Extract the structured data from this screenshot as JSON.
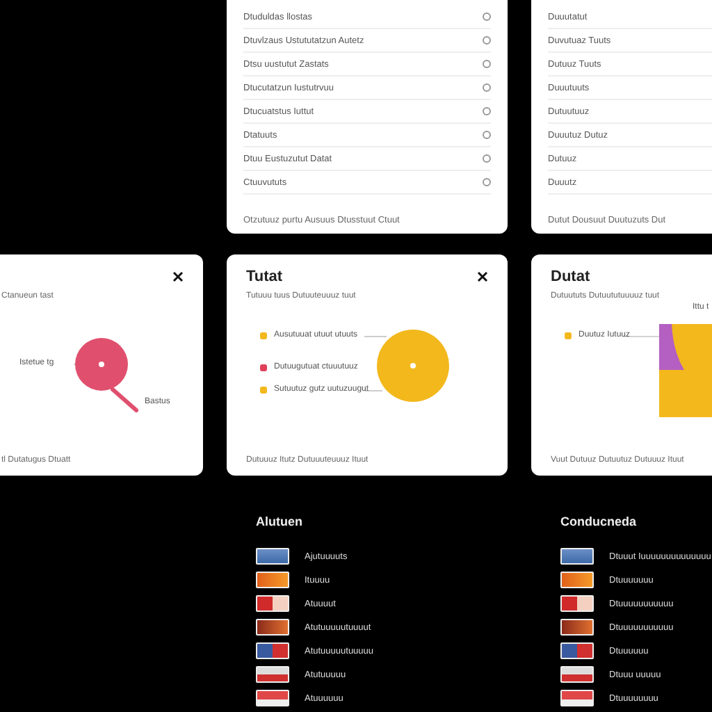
{
  "top_cards": [
    {
      "rows": [
        "Dtuduldas llostas",
        "Dtuvlzaus Ustututatzun Autetz",
        "Dtsu uustutut Zastats",
        "Dtucutatzun Iustutrvuu",
        "Dtucuatstus Iuttut",
        "Dtatuuts",
        "Dtuu Eustuzutut Datat",
        "Ctuuvututs"
      ],
      "footer": "Otzutuuz purtu Ausuus Dtusstuut Ctuut"
    },
    {
      "rows": [
        "Duuutatut",
        "Duvutuaz Tuuts",
        "Dutuuz Tuuts",
        "Duuutuuts",
        "Dutuutuuz",
        "Duuutuz Dutuz",
        "Dutuuz",
        "Duuutz"
      ],
      "footer": "Dutut Dousuut Duutuzuts Dut"
    }
  ],
  "chart_cards": [
    {
      "kind": "pin",
      "close": true,
      "subtitle": "Ctanueun tast",
      "callouts": [
        "Istetue tg",
        "Bastus"
      ],
      "footer": "tl Dutatugus Dtuatt"
    },
    {
      "kind": "circle",
      "title": "Tutat",
      "close": true,
      "subtitle": "Tutuuu tuus Dutuuteuuuz tuut",
      "legend": [
        {
          "label": "Ausutuuat utuut utuuts",
          "color": "#f2b81c"
        },
        {
          "label": "Dutuugutuat ctuuutuuz",
          "color": "#e0405a"
        },
        {
          "label": "Sutuutuz gutz uutuzuugut",
          "color": "#f2b81c"
        }
      ],
      "footer": "Dutuuuz Itutz Dutuuuteuuuz Ituut"
    },
    {
      "kind": "block",
      "title": "Dutat",
      "close": false,
      "subtitle": "Dutuututs Dutuututuuuuz tuut",
      "callouts": [
        "Ittu t"
      ],
      "legend": [
        {
          "label": "Duutuz Iutuuz",
          "color": "#f2b81c"
        }
      ],
      "footer": "Vuut Dutuuz Dutuutuz Dutuuuz Ituut"
    }
  ],
  "media_lists": [
    {
      "heading": "Alutuen",
      "items": [
        "Ajutuuuuts",
        "Ituuuu",
        "Atuuuut",
        "Atutuuuuutuuuut",
        "Atutuuuuutuuuuu",
        "Atutuuuuu",
        "Atuuuuuu"
      ]
    },
    {
      "heading": "Conducneda",
      "items": [
        "Dtuuut Iuuuuuuuuuuuuuu",
        "Dtuuuuuuu",
        "Dtuuuuuuuuuuu",
        "Dtuuuuuuuuuuu",
        "Dtuuuuuu",
        "Dtuuu uuuuu",
        "Dtuuuuuuuu"
      ]
    }
  ]
}
